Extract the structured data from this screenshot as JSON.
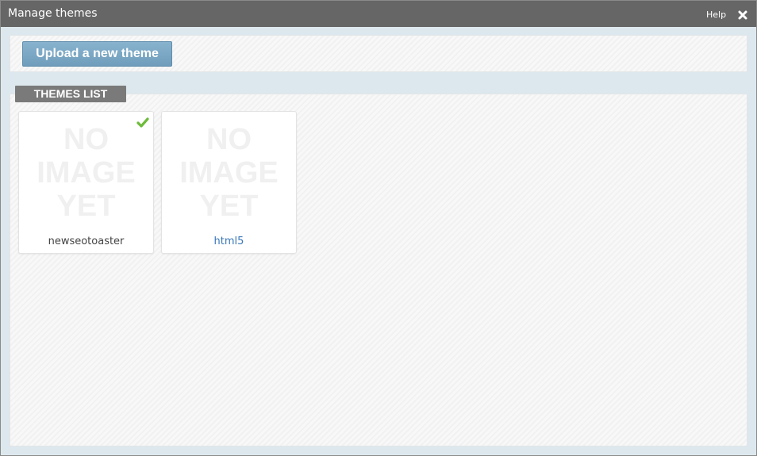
{
  "window": {
    "title": "Manage themes",
    "help_label": "Help",
    "close_icon": "close-icon"
  },
  "toolbar": {
    "upload_label": "Upload a new theme"
  },
  "themes_list": {
    "heading": "THEMES LIST",
    "items": [
      {
        "placeholder_lines": [
          "NO",
          "IMAGE",
          "YET"
        ],
        "name": "newseotoaster",
        "active": true,
        "name_color": "#444444"
      },
      {
        "placeholder_lines": [
          "NO",
          "IMAGE",
          "YET"
        ],
        "name": "html5",
        "active": false,
        "name_color": "#3a78b8"
      }
    ]
  },
  "colors": {
    "accent": "#7aa7c7",
    "active_check": "#6dbb3a",
    "titlebar": "#666666"
  }
}
